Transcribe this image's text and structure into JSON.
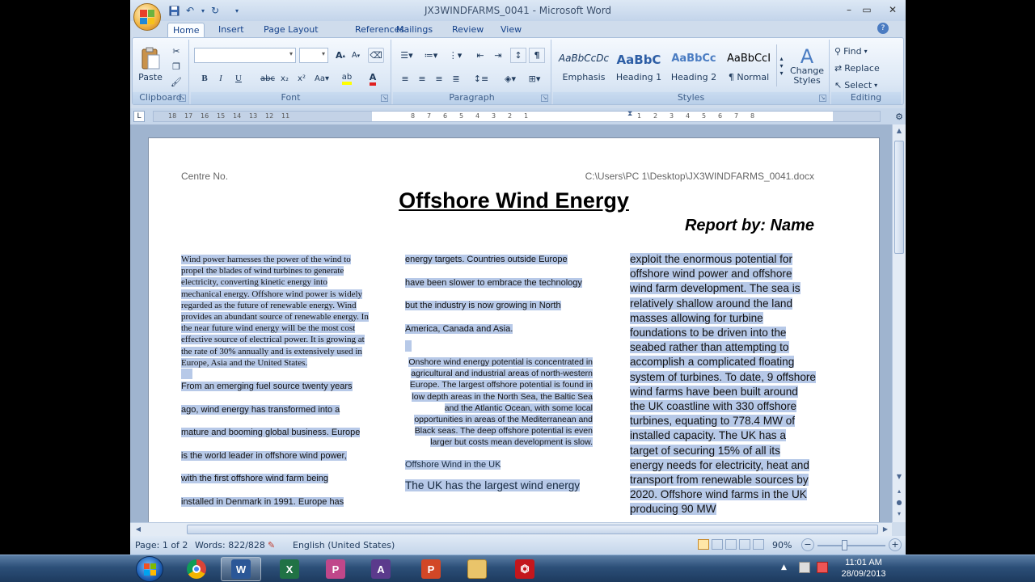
{
  "window": {
    "title": "JX3WINDFARMS_0041 - Microsoft Word",
    "minimize": "–",
    "maximize": "▭",
    "close": "✕"
  },
  "tabs": [
    "Home",
    "Insert",
    "Page Layout",
    "References",
    "Mailings",
    "Review",
    "View"
  ],
  "ribbon": {
    "groups": [
      "Clipboard",
      "Font",
      "Paragraph",
      "Styles",
      "Editing"
    ],
    "paste_label": "Paste",
    "styles": [
      {
        "preview": "AaBbCcDc",
        "name": "Emphasis"
      },
      {
        "preview": "AaBbC",
        "name": "Heading 1"
      },
      {
        "preview": "AaBbCc",
        "name": "Heading 2"
      },
      {
        "preview": "AaBbCcI",
        "name": "¶ Normal"
      }
    ],
    "change_styles": "Change\nStyles",
    "find": "Find",
    "replace": "Replace",
    "select": "Select"
  },
  "ruler": {
    "ticks": [
      "18",
      "17",
      "16",
      "15",
      "14",
      "13",
      "12",
      "11",
      "8",
      "7",
      "6",
      "5",
      "4",
      "3",
      "2",
      "1",
      "1",
      "2",
      "3",
      "4",
      "5",
      "6",
      "7",
      "8"
    ]
  },
  "document": {
    "header_left": "Centre No.",
    "header_right": "C:\\Users\\PC 1\\Desktop\\JX3WINDFARMS_0041.docx",
    "title": "Offshore Wind Energy",
    "byline": "Report by: Name",
    "col1_para1": "Wind power harnesses the power of the wind to propel the blades of wind turbines to generate electricity, converting kinetic energy into mechanical energy.  Offshore wind power is widely regarded as the future of renewable energy.  Wind provides an abundant source of renewable energy.  In the near future wind energy will be the most cost effective source of electrical power.  It is growing at the rate of 30% annually and is extensively used in Europe, Asia and the United States.",
    "col1_lines": [
      "From an emerging fuel source twenty years",
      "ago, wind energy has transformed into a",
      "mature and booming global business.  Europe",
      "is the world leader in offshore wind power,",
      "with the first offshore wind farm being",
      "installed in Denmark in 1991.  Europe has"
    ],
    "col2_lines": [
      "energy targets.  Countries outside Europe",
      "have been slower to embrace the technology",
      "but the industry is now growing in North",
      "America, Canada and Asia."
    ],
    "col2_para2": "Onshore wind energy potential is concentrated in agricultural and industrial areas of north-western Europe.  The largest offshore potential is found in low depth areas in the North Sea, the Baltic Sea and the Atlantic Ocean, with some local opportunities in areas of the Mediterranean and Black seas. The deep offshore potential is even larger but costs mean development is slow.",
    "col2_subhead": "Offshore Wind in the UK",
    "col2_bigline": "The UK has the largest wind energy",
    "col3_text": "exploit the enormous potential for offshore wind power and offshore wind farm development.  The sea is relatively shallow around the land masses allowing for turbine foundations to be driven into the seabed rather than attempting to accomplish a complicated floating system of turbines.  To date, 9 offshore wind farms have been built around the UK coastline with 330 offshore turbines, equating to 778.4 MW of installed capacity.  The UK has a target of securing 15% of all its energy needs for electricity, heat and transport from renewable sources by 2020.  Offshore wind farms in the UK producing 90 MW"
  },
  "status": {
    "page": "Page: 1 of 2",
    "words": "Words: 822/828",
    "language": "English (United States)",
    "zoom": "90%"
  },
  "taskbar": {
    "clock_time": "11:01 AM",
    "clock_date": "28/09/2013"
  },
  "colors": {
    "selection": "#b7c9e8",
    "ribbon": "#dbe7f5",
    "taskbar": "#2c4f78"
  }
}
